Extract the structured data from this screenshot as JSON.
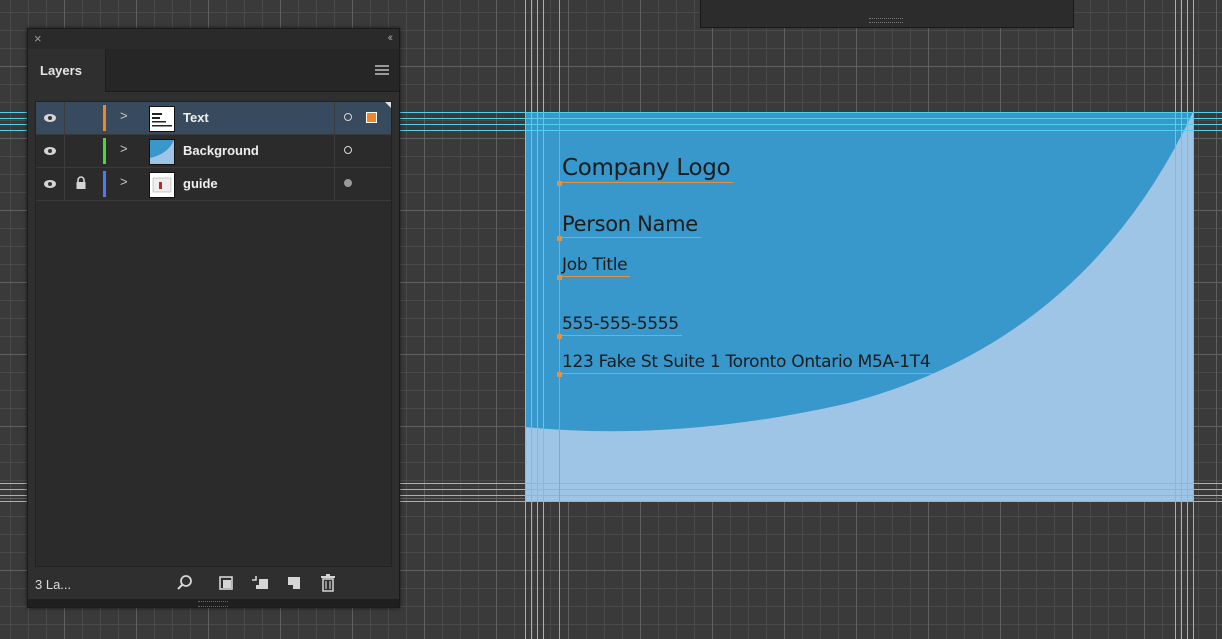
{
  "app": "Adobe Illustrator",
  "layers_panel": {
    "tab_label": "Layers",
    "footer_count": "3 La...",
    "layers": [
      {
        "name": "Text",
        "color": "#f0862a",
        "locked": false,
        "selected": true
      },
      {
        "name": "Background",
        "color": "#4fd14a",
        "locked": false,
        "selected": false
      },
      {
        "name": "guide",
        "color": "#5577ee",
        "locked": true,
        "selected": false
      }
    ],
    "footer_icons": [
      "search-icon",
      "make-clipping-mask-icon",
      "create-sublayer-icon",
      "new-layer-icon",
      "delete-icon"
    ]
  },
  "artboard": {
    "company_logo": "Company Logo",
    "person_name": "Person Name",
    "job_title": "Job Title",
    "phone": "555-555-5555",
    "address": "123 Fake St Suite 1 Toronto Ontario M5A-1T4",
    "colors": {
      "dark_blue": "#3897cb",
      "light_blue": "#9fc5e6"
    }
  },
  "colors": {
    "guide": "#4ed3ea",
    "accent": "#f0862a"
  }
}
